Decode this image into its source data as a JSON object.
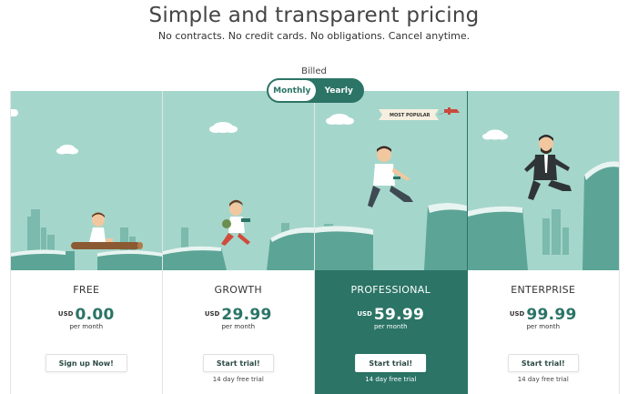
{
  "header": {
    "title": "Simple and transparent pricing",
    "subtitle": "No contracts. No credit cards. No obligations. Cancel anytime."
  },
  "billing": {
    "label": "Billed",
    "options": [
      "Monthly",
      "Yearly"
    ],
    "selected": "Yearly"
  },
  "colors": {
    "brand": "#2b7466",
    "scene_sky": "#a5d6cb",
    "cliff": "#5ca596",
    "city": "#7bbaad"
  },
  "banner": {
    "text": "MOST POPULAR"
  },
  "plans": [
    {
      "name": "FREE",
      "currency": "USD",
      "price": "0.00",
      "period": "per month",
      "cta": "Sign up Now!",
      "note": "",
      "featured": false,
      "illustration": "person-on-log-icon"
    },
    {
      "name": "GROWTH",
      "currency": "USD",
      "price": "29.99",
      "period": "per month",
      "cta": "Start trial!",
      "note": "14 day free trial",
      "featured": false,
      "illustration": "person-running-icon"
    },
    {
      "name": "PROFESSIONAL",
      "currency": "USD",
      "price": "59.99",
      "period": "per month",
      "cta": "Start trial!",
      "note": "14 day free trial",
      "featured": true,
      "illustration": "person-jumping-icon"
    },
    {
      "name": "ENTERPRISE",
      "currency": "USD",
      "price": "99.99",
      "period": "per month",
      "cta": "Start trial!",
      "note": "14 day free trial",
      "featured": false,
      "illustration": "businessman-leaping-icon"
    }
  ]
}
